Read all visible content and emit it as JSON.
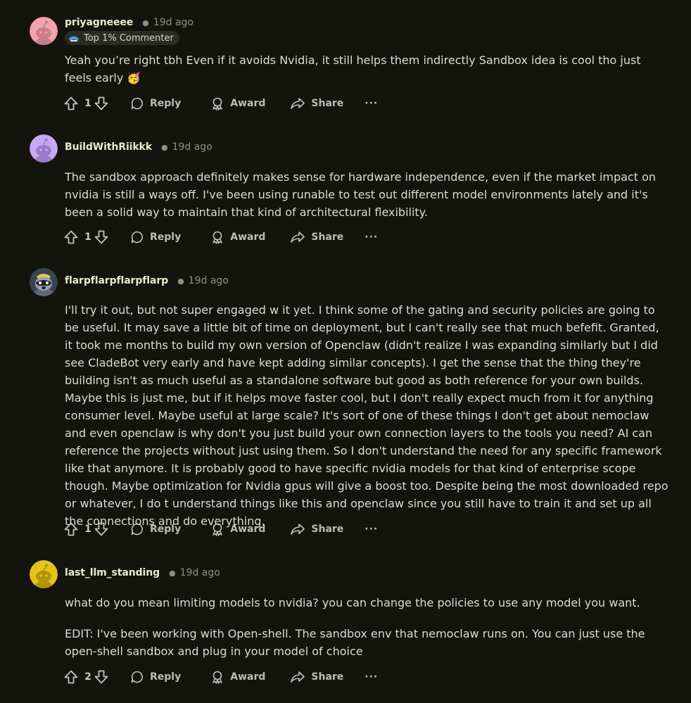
{
  "comments": [
    {
      "username": "priyagneeee",
      "time": "19d ago",
      "flair": "Top 1% Commenter",
      "paragraphs": [
        "Yeah you’re right tbh Even if it avoids Nvidia, it still helps them indirectly Sandbox idea is cool tho just feels early 🥳"
      ],
      "votes": "1",
      "avatar_color": "#f4a3ae"
    },
    {
      "username": "BuildWithRiikkk",
      "time": "19d ago",
      "paragraphs": [
        "The sandbox approach definitely makes sense for hardware independence, even if the market impact on nvidia is still a ways off. I've been using runable to test out different model environments lately and it's been a solid way to maintain that kind of architectural flexibility."
      ],
      "votes": "1",
      "avatar_color": "#c9a7f2"
    },
    {
      "username": "flarpflarpflarpflarp",
      "time": "19d ago",
      "paragraphs": [
        "I'll try it out, but not super engaged w it yet. I think some of the gating and security policies are going to be useful. It may save a little bit of time on deployment, but I can't really see that much befefit. Granted, it took me months to build my own version of Openclaw (didn't realize I was expanding similarly but I did see CladeBot very early and have kept adding similar concepts). I get the sense that the thing they're building isn't as much useful as a standalone software but good as both reference for your own builds. Maybe this is just me, but if it helps move faster cool, but I don't really expect much from it for anything consumer level. Maybe useful at large scale? It's sort of one of these things I don't get about nemoclaw and even openclaw is why don't you just build your own connection layers to the tools you need? AI can reference the projects without just using them. So I don't understand the need for any specific framework like that anymore. It is probably good to have specific nvidia models for that kind of enterprise scope though. Maybe optimization for Nvidia gpus will give a boost too. Despite being the most downloaded repo or whatever, I do t understand things like this and openclaw since you still have to train it and set up all the connections and do everything."
      ],
      "votes": "1",
      "avatar_color": "#6f7a84"
    },
    {
      "username": "last_llm_standing",
      "time": "19d ago",
      "paragraphs": [
        "what do you mean limiting models to nvidia? you can change the policies to use any model you want.",
        "EDIT: I've been working with Open-shell. The sandbox env that nemoclaw runs on. You can just use the open-shell sandbox and plug in your model of choice"
      ],
      "votes": "2",
      "avatar_color": "#e6c21c"
    }
  ],
  "actions": {
    "reply": "Reply",
    "award": "Award",
    "share": "Share",
    "more": "···"
  },
  "icons": [
    "upvote-icon",
    "downvote-icon",
    "reply-icon",
    "award-icon",
    "share-icon",
    "more-icon",
    "flair-icon"
  ]
}
